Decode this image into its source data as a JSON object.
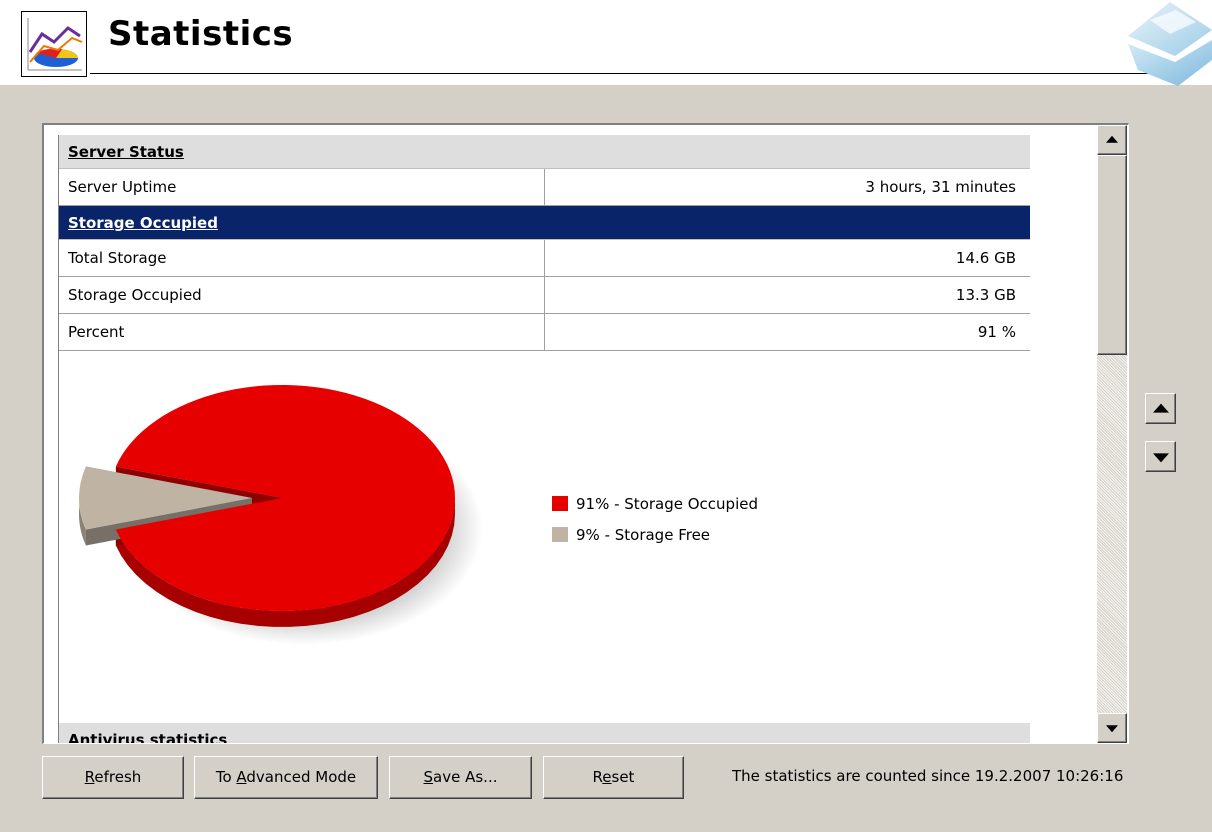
{
  "window": {
    "title": "Statistics",
    "icon": "statistics-pie-icon",
    "brand_logo": "diamond-logo"
  },
  "sections": {
    "server_status": {
      "title": "Server Status",
      "rows": [
        {
          "label": "Server Uptime",
          "value": "3 hours, 31 minutes"
        }
      ]
    },
    "storage_occupied": {
      "title": "Storage Occupied",
      "selected": true,
      "rows": [
        {
          "label": "Total Storage",
          "value": "14.6 GB"
        },
        {
          "label": "Storage Occupied",
          "value": "13.3 GB"
        },
        {
          "label": "Percent",
          "value": "91 %"
        }
      ]
    },
    "antivirus": {
      "title": "Antivirus statistics"
    }
  },
  "chart_data": {
    "type": "pie",
    "slices": [
      {
        "label": "91% - Storage Occupied",
        "value": 91,
        "color": "#e60000"
      },
      {
        "label": "9% - Storage Free",
        "value": 9,
        "color": "#bfb4a4"
      }
    ]
  },
  "scrollbar": {
    "up_icon": "scroll-up-arrow-icon",
    "down_icon": "scroll-down-arrow-icon"
  },
  "side_nav": {
    "up_icon": "move-up-arrow-icon",
    "down_icon": "move-down-arrow-icon"
  },
  "buttons": {
    "refresh": {
      "pre": "",
      "key": "R",
      "post": "efresh"
    },
    "advanced": {
      "pre": "To ",
      "key": "A",
      "post": "dvanced Mode"
    },
    "save_as": {
      "pre": "",
      "key": "S",
      "post": "ave As..."
    },
    "reset": {
      "pre": "R",
      "key": "e",
      "post": "set"
    }
  },
  "status": {
    "text": "The statistics are counted since 19.2.2007 10:26:16"
  },
  "colors": {
    "selection": "#0a246a",
    "section_header": "#dedede",
    "window_bg": "#d4d0c8"
  }
}
